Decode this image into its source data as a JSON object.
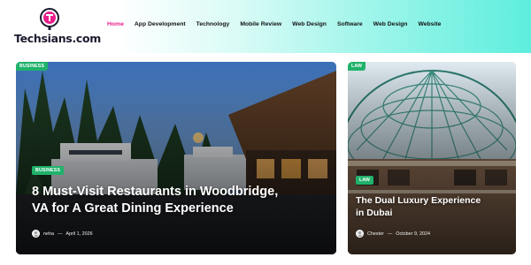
{
  "site": {
    "logo_text": "Techsians.com",
    "logo_icon": "magnifier-t-logo",
    "colors": {
      "accent": "#e91e8c",
      "badge": "#20b26b",
      "header_gradient_end": "#5eeedd"
    }
  },
  "nav": {
    "items": [
      {
        "label": "Home",
        "active": true
      },
      {
        "label": "App Development"
      },
      {
        "label": "Technology"
      },
      {
        "label": "Mobile Review"
      },
      {
        "label": "Web Design"
      },
      {
        "label": "Software"
      },
      {
        "label": "Web Design"
      },
      {
        "label": "Website"
      }
    ]
  },
  "featured": [
    {
      "category_top": "BUSINESS",
      "category": "BUSINESS",
      "title": "8 Must-Visit Restaurants in Woodbridge, VA for A Great Dining Experience",
      "author": "neha",
      "date": "April 1, 2026",
      "image": "restaurant-marina-dusk-photo"
    },
    {
      "category_top": "LAW",
      "category": "LAW",
      "title": "The Dual Luxury Experience in Dubai",
      "author": "Chester",
      "date": "October 9, 2024",
      "image": "dubai-mall-glass-dome-photo"
    }
  ]
}
